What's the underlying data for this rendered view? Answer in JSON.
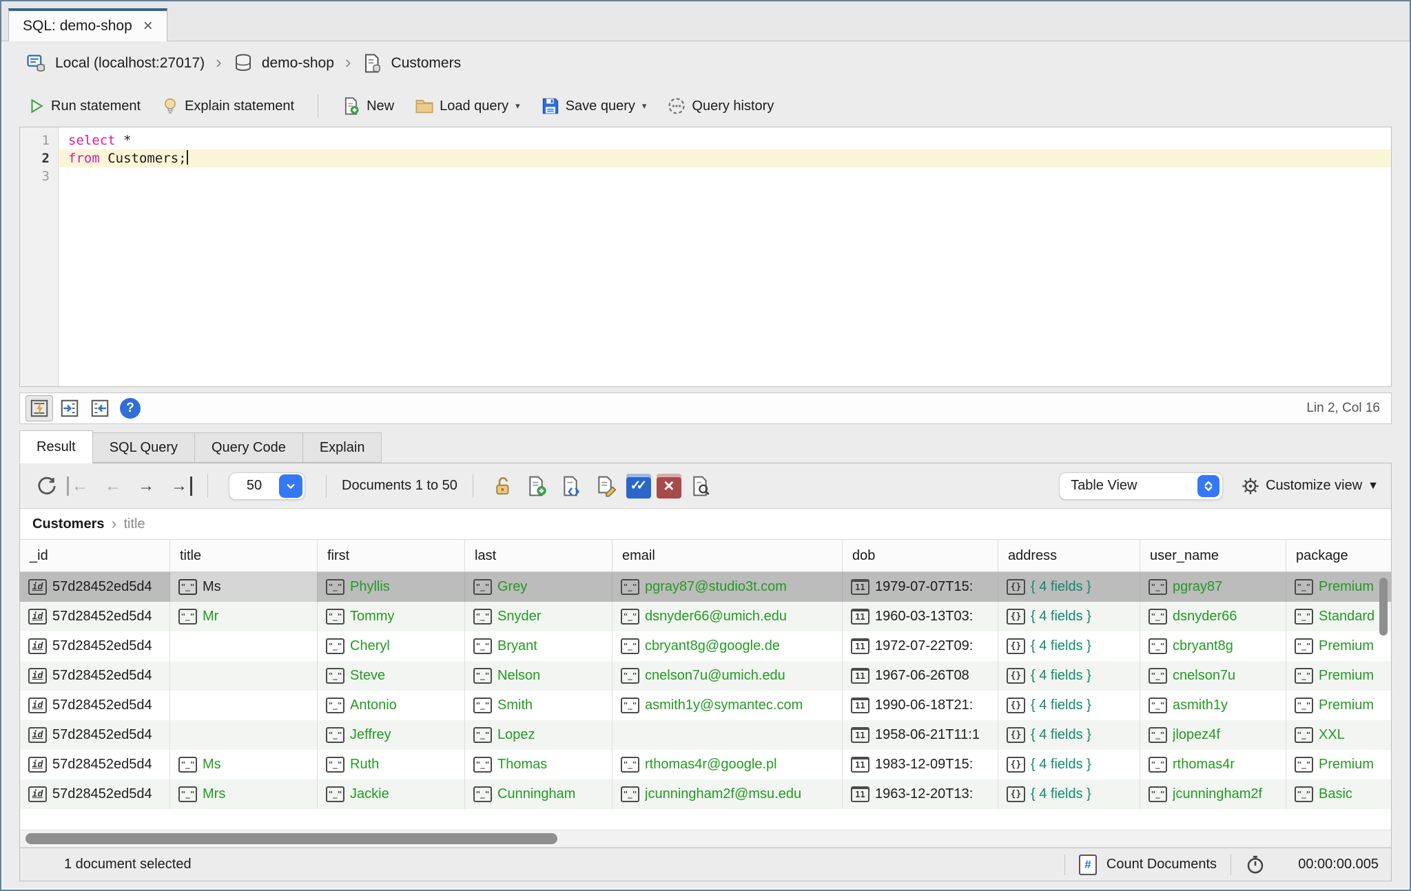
{
  "window": {
    "tab_title": "SQL: demo-shop",
    "close_glyph": "×"
  },
  "breadcrumb": {
    "connection": "Local (localhost:27017)",
    "database": "demo-shop",
    "collection": "Customers",
    "separator": "›"
  },
  "toolbar": {
    "run": "Run statement",
    "explain": "Explain statement",
    "new": "New",
    "load": "Load query",
    "save": "Save query",
    "history": "Query history",
    "dropdown_arrow": "▾"
  },
  "editor": {
    "lines": [
      {
        "num": "1",
        "keyword": "select",
        "rest": " *"
      },
      {
        "num": "2",
        "keyword": "from",
        "rest": " Customers;"
      },
      {
        "num": "3",
        "keyword": "",
        "rest": ""
      }
    ],
    "status": "Lin 2, Col 16"
  },
  "result_tabs": [
    {
      "label": "Result",
      "active": true
    },
    {
      "label": "SQL Query",
      "active": false
    },
    {
      "label": "Query Code",
      "active": false
    },
    {
      "label": "Explain",
      "active": false
    }
  ],
  "result_toolbar": {
    "page_size": "50",
    "documents_label": "Documents 1 to 50",
    "view_mode": "Table View",
    "customize_label": "Customize view",
    "customize_arrow": "▼",
    "nav_first": "←",
    "nav_prev": "←",
    "nav_next": "→",
    "nav_last": "→"
  },
  "result_breadcrumb": {
    "collection": "Customers",
    "separator": "›",
    "field": "title"
  },
  "table": {
    "columns": [
      "_id",
      "title",
      "first",
      "last",
      "email",
      "dob",
      "address",
      "user_name",
      "package"
    ],
    "cell_type_icons": {
      "id": "id",
      "str": "\"_\"",
      "date": "11",
      "obj": "{}"
    },
    "rows": [
      {
        "selected": true,
        "cells": [
          {
            "type": "id",
            "text": "57d28452ed5d4"
          },
          {
            "type": "str",
            "text": "Ms",
            "focused": true
          },
          {
            "type": "str",
            "text": "Phyllis"
          },
          {
            "type": "str",
            "text": "Grey"
          },
          {
            "type": "str",
            "text": "pgray87@studio3t.com"
          },
          {
            "type": "date",
            "text": "1979-07-07T15:"
          },
          {
            "type": "obj",
            "text": "{ 4 fields }"
          },
          {
            "type": "str",
            "text": "pgray87"
          },
          {
            "type": "str",
            "text": "Premium"
          }
        ]
      },
      {
        "selected": false,
        "cells": [
          {
            "type": "id",
            "text": "57d28452ed5d4"
          },
          {
            "type": "str",
            "text": "Mr"
          },
          {
            "type": "str",
            "text": "Tommy"
          },
          {
            "type": "str",
            "text": "Snyder"
          },
          {
            "type": "str",
            "text": "dsnyder66@umich.edu"
          },
          {
            "type": "date",
            "text": "1960-03-13T03:"
          },
          {
            "type": "obj",
            "text": "{ 4 fields }"
          },
          {
            "type": "str",
            "text": "dsnyder66"
          },
          {
            "type": "str",
            "text": "Standard"
          }
        ]
      },
      {
        "selected": false,
        "cells": [
          {
            "type": "id",
            "text": "57d28452ed5d4"
          },
          {
            "type": "empty",
            "text": ""
          },
          {
            "type": "str",
            "text": "Cheryl"
          },
          {
            "type": "str",
            "text": "Bryant"
          },
          {
            "type": "str",
            "text": "cbryant8g@google.de"
          },
          {
            "type": "date",
            "text": "1972-07-22T09:"
          },
          {
            "type": "obj",
            "text": "{ 4 fields }"
          },
          {
            "type": "str",
            "text": "cbryant8g"
          },
          {
            "type": "str",
            "text": "Premium"
          }
        ]
      },
      {
        "selected": false,
        "cells": [
          {
            "type": "id",
            "text": "57d28452ed5d4"
          },
          {
            "type": "empty",
            "text": ""
          },
          {
            "type": "str",
            "text": "Steve"
          },
          {
            "type": "str",
            "text": "Nelson"
          },
          {
            "type": "str",
            "text": "cnelson7u@umich.edu"
          },
          {
            "type": "date",
            "text": "1967-06-26T08"
          },
          {
            "type": "obj",
            "text": "{ 4 fields }"
          },
          {
            "type": "str",
            "text": "cnelson7u"
          },
          {
            "type": "str",
            "text": "Premium"
          }
        ]
      },
      {
        "selected": false,
        "cells": [
          {
            "type": "id",
            "text": "57d28452ed5d4"
          },
          {
            "type": "empty",
            "text": ""
          },
          {
            "type": "str",
            "text": "Antonio"
          },
          {
            "type": "str",
            "text": "Smith"
          },
          {
            "type": "str",
            "text": "asmith1y@symantec.com"
          },
          {
            "type": "date",
            "text": "1990-06-18T21:"
          },
          {
            "type": "obj",
            "text": "{ 4 fields }"
          },
          {
            "type": "str",
            "text": "asmith1y"
          },
          {
            "type": "str",
            "text": "Premium"
          }
        ]
      },
      {
        "selected": false,
        "cells": [
          {
            "type": "id",
            "text": "57d28452ed5d4"
          },
          {
            "type": "empty",
            "text": ""
          },
          {
            "type": "str",
            "text": "Jeffrey"
          },
          {
            "type": "str",
            "text": "Lopez"
          },
          {
            "type": "empty",
            "text": ""
          },
          {
            "type": "date",
            "text": "1958-06-21T11:1"
          },
          {
            "type": "obj",
            "text": "{ 4 fields }"
          },
          {
            "type": "str",
            "text": "jlopez4f"
          },
          {
            "type": "str",
            "text": "XXL"
          }
        ]
      },
      {
        "selected": false,
        "cells": [
          {
            "type": "id",
            "text": "57d28452ed5d4"
          },
          {
            "type": "str",
            "text": "Ms"
          },
          {
            "type": "str",
            "text": "Ruth"
          },
          {
            "type": "str",
            "text": "Thomas"
          },
          {
            "type": "str",
            "text": "rthomas4r@google.pl"
          },
          {
            "type": "date",
            "text": "1983-12-09T15:"
          },
          {
            "type": "obj",
            "text": "{ 4 fields }"
          },
          {
            "type": "str",
            "text": "rthomas4r"
          },
          {
            "type": "str",
            "text": "Premium"
          }
        ]
      },
      {
        "selected": false,
        "cells": [
          {
            "type": "id",
            "text": "57d28452ed5d4"
          },
          {
            "type": "str",
            "text": "Mrs"
          },
          {
            "type": "str",
            "text": "Jackie"
          },
          {
            "type": "str",
            "text": "Cunningham"
          },
          {
            "type": "str",
            "text": "jcunningham2f@msu.edu"
          },
          {
            "type": "date",
            "text": "1963-12-20T13:"
          },
          {
            "type": "obj",
            "text": "{ 4 fields }"
          },
          {
            "type": "str",
            "text": "jcunningham2f"
          },
          {
            "type": "str",
            "text": "Basic"
          }
        ]
      }
    ]
  },
  "status_bar": {
    "selection": "1 document selected",
    "count_button": "Count Documents",
    "count_glyph": "#",
    "timer": "00:00:00.005"
  }
}
